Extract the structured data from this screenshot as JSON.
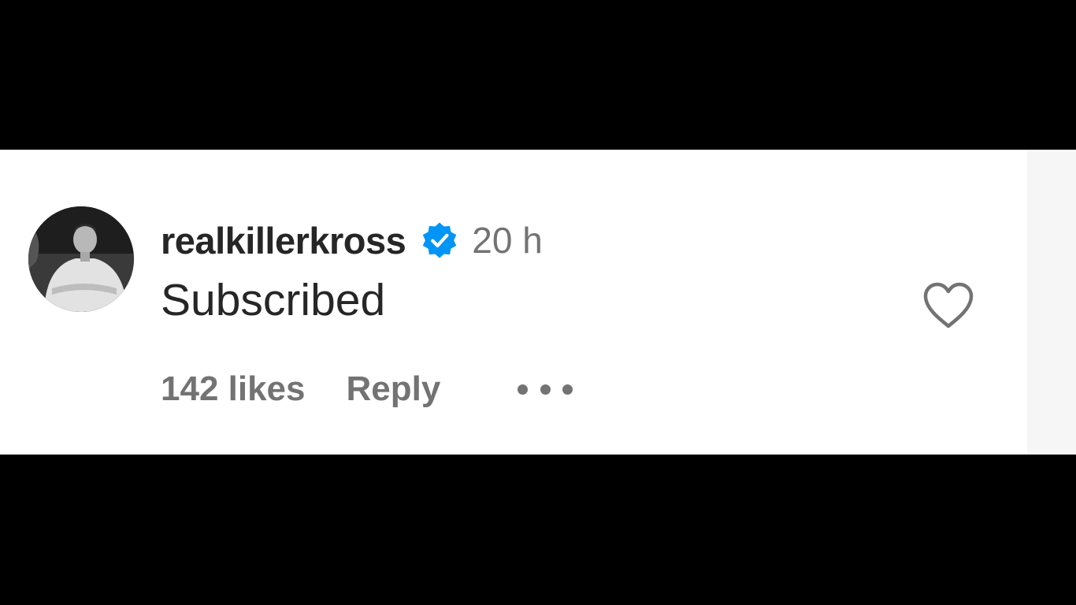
{
  "comment": {
    "username": "realkillerkross",
    "verified_icon": "verified-badge-icon",
    "timestamp": "20 h",
    "text": "Subscribed",
    "likes": "142 likes",
    "reply_label": "Reply",
    "more_icon": "more-options-icon",
    "like_icon": "heart-outline-icon"
  },
  "colors": {
    "background": "#000000",
    "card": "#ffffff",
    "primary_text": "#262626",
    "secondary_text": "#737373",
    "verified_blue": "#0095f6"
  }
}
